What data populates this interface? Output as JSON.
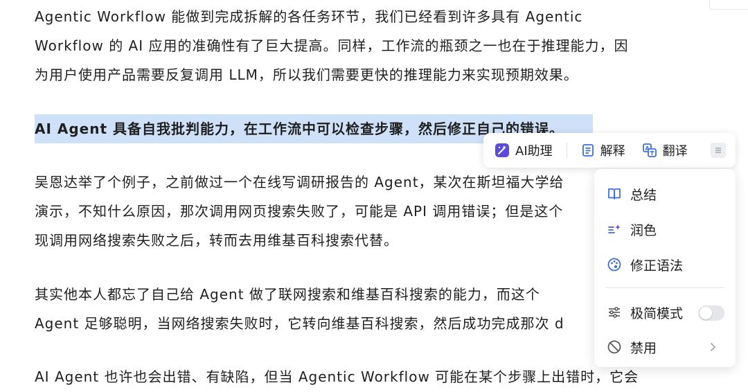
{
  "article": {
    "p1": [
      "Agentic Workflow 能做到完成拆解的各任务环节，我们已经看到许多具有 Agentic",
      "Workflow 的 AI 应用的准确性有了巨大提高。同样，工作流的瓶颈之一也在于推理能力，因",
      "为用户使用产品需要反复调用 LLM，所以我们需要更快的推理能力来实现预期效果。"
    ],
    "highlighted": "AI Agent 具备自我批判能力，在工作流中可以检查步骤，然后修正自己的错误。",
    "p2": [
      "吴恩达举了个例子，之前做过一个在线写调研报告的 Agent，某次在斯坦福大学给",
      "演示，不知什么原因，那次调用网页搜索失败了，可能是 API 调用错误；但是这个",
      "现调用网络搜索失败之后，转而去用维基百科搜索代替。"
    ],
    "p3": [
      "其实他本人都忘了自己给 Agent 做了联网搜索和维基百科搜索的能力，而这个",
      "Agent 足够聪明，当网络搜索失败时，它转向维基百科搜索，然后成功完成那次 d"
    ],
    "p4": [
      "AI Agent 也许也会出错、有缺陷，但当 Agentic Workflow 可能在某个步骤上出错时，它会"
    ]
  },
  "toolbar": {
    "ai_assistant": "AI助理",
    "explain": "解释",
    "translate": "翻译"
  },
  "menu": {
    "summarize": "总结",
    "polish": "润色",
    "fix_grammar": "修正语法",
    "minimal_mode": "极简模式",
    "disable": "禁用"
  },
  "colors": {
    "selection": "#cfe0f9",
    "accent": "#5b4bdb",
    "icon_blue": "#3b6fe0"
  }
}
